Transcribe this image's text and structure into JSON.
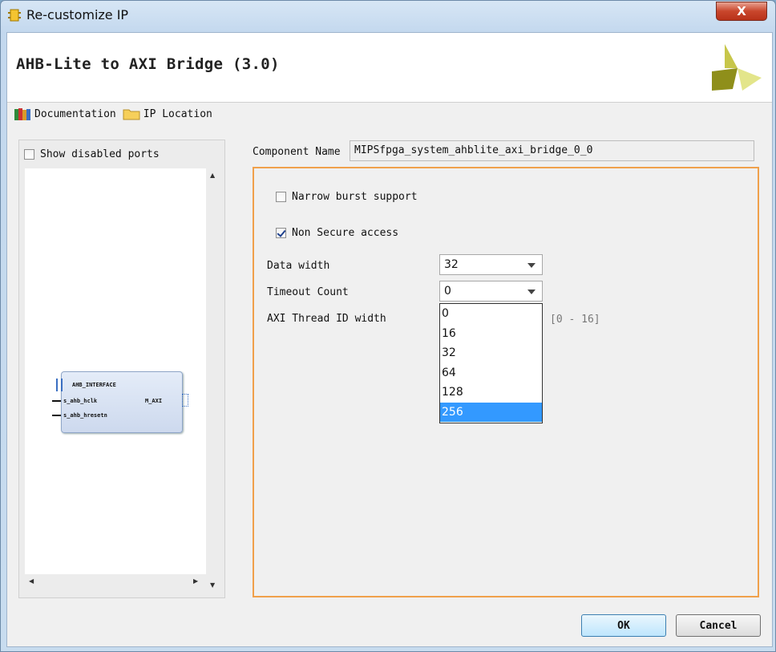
{
  "window": {
    "title": "Re-customize IP",
    "close_symbol": "X"
  },
  "header": {
    "title": "AHB-Lite to AXI Bridge (3.0)"
  },
  "toolbar": {
    "documentation": "Documentation",
    "ip_location": "IP Location"
  },
  "left_panel": {
    "show_disabled_ports": {
      "label": "Show disabled ports",
      "checked": false
    },
    "ip_block": {
      "interface": "AHB_INTERFACE",
      "clk": "s_ahb_hclk",
      "reset": "s_ahb_hresetn",
      "axi": "M_AXI"
    }
  },
  "component_name": {
    "label": "Component Name",
    "value": "MIPSfpga_system_ahblite_axi_bridge_0_0"
  },
  "options": {
    "narrow_burst": {
      "label": "Narrow burst support",
      "checked": false
    },
    "non_secure": {
      "label": "Non Secure access",
      "checked": true
    }
  },
  "params": {
    "data_width": {
      "label": "Data width",
      "value": "32"
    },
    "timeout_count": {
      "label": "Timeout Count",
      "value": "0"
    },
    "axi_thread_id": {
      "label": "AXI Thread ID width",
      "range": "[0 - 16]"
    }
  },
  "dropdown": {
    "options": [
      "0",
      "16",
      "32",
      "64",
      "128",
      "256"
    ],
    "highlighted": "256"
  },
  "buttons": {
    "ok": "OK",
    "cancel": "Cancel"
  },
  "colors": {
    "accent_border": "#f0a04b",
    "selection": "#3399ff"
  }
}
